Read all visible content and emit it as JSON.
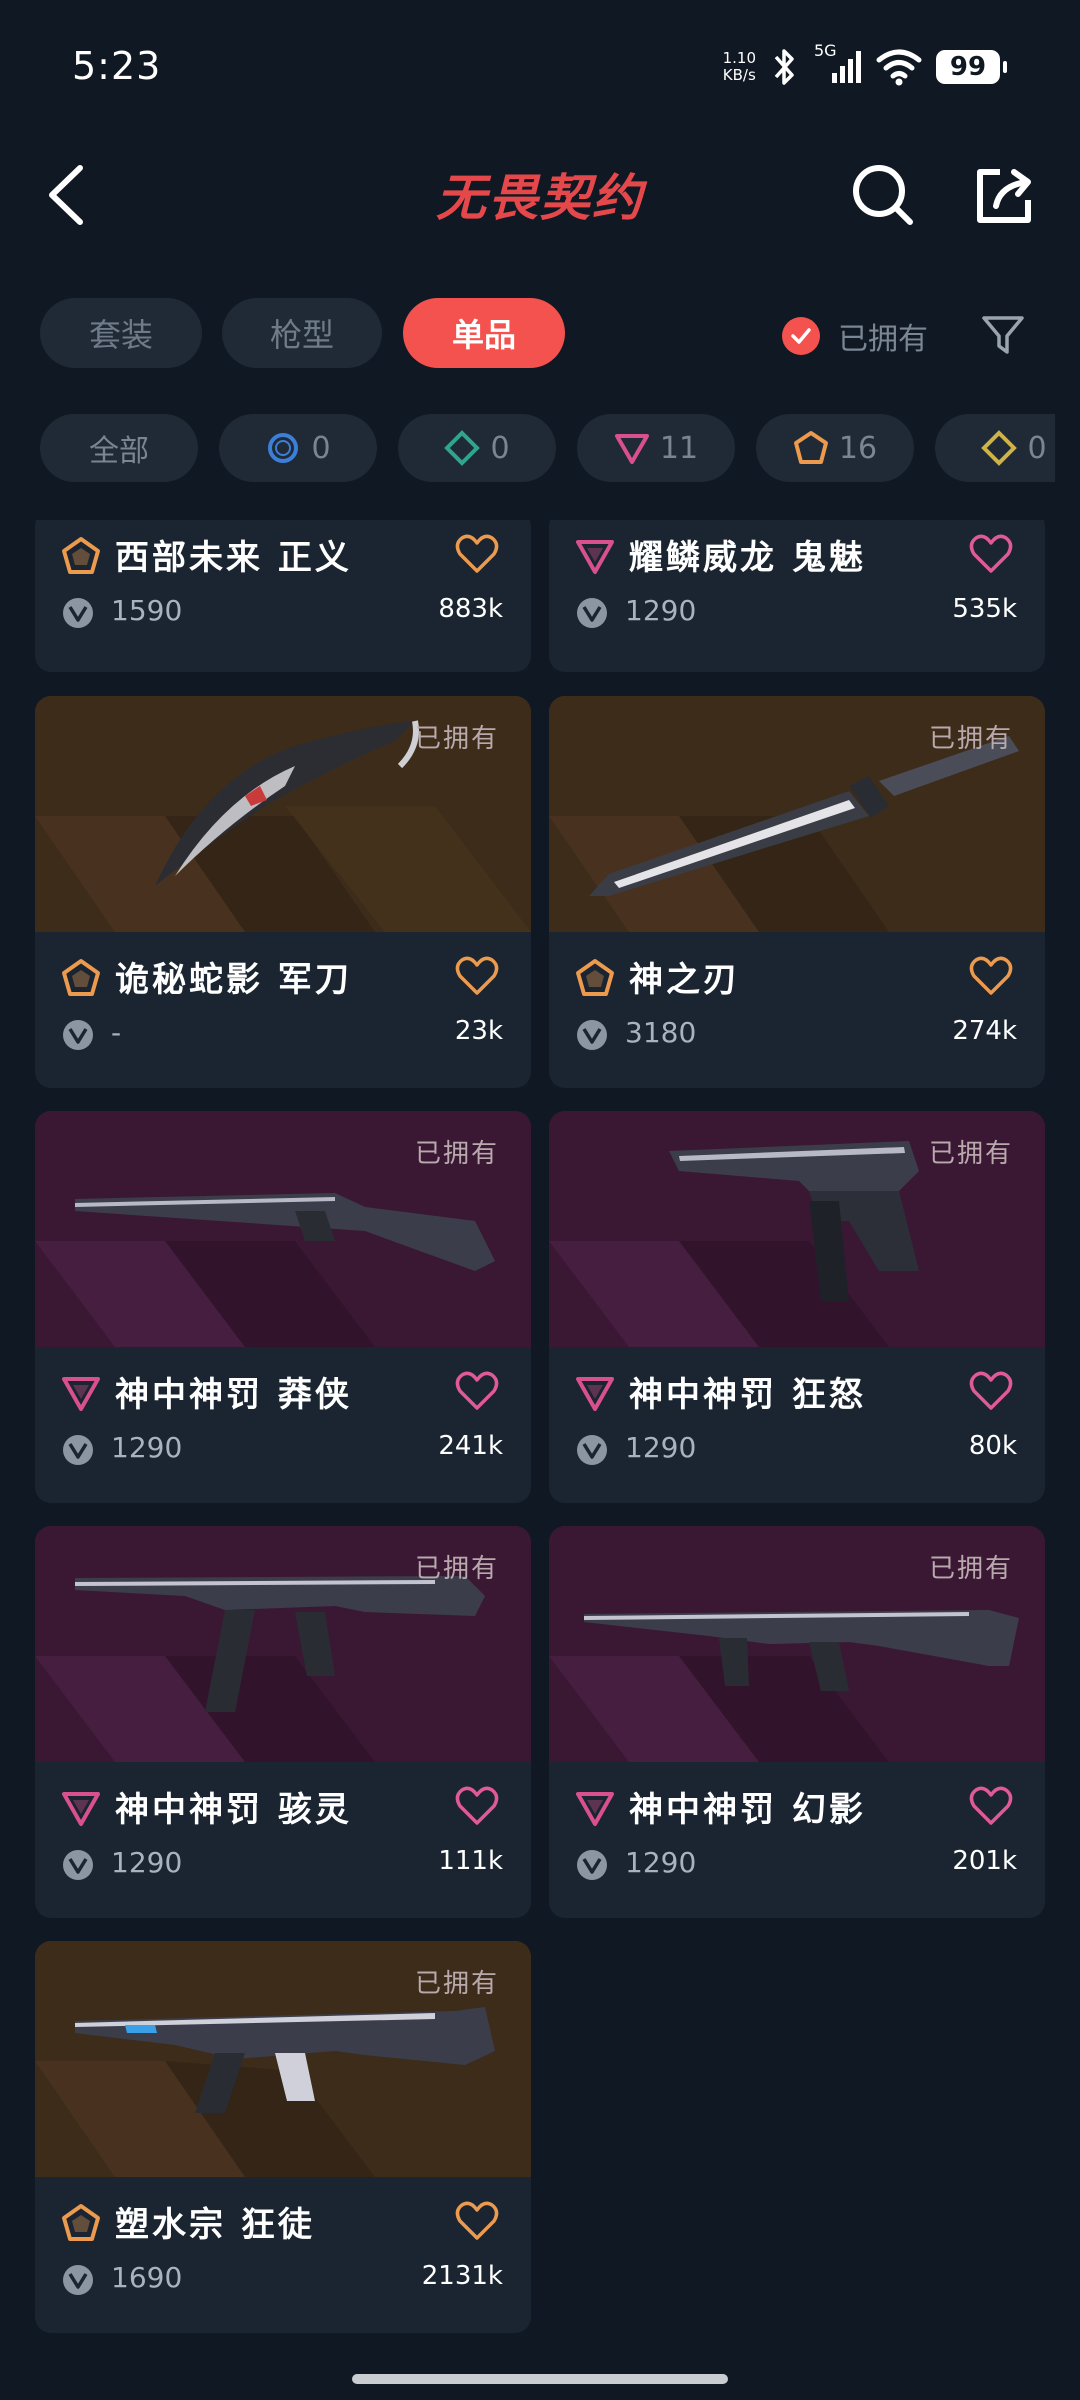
{
  "status": {
    "time": "5:23",
    "net_speed": "1.10",
    "net_unit": "KB/s",
    "signal_label": "5G",
    "battery": "99"
  },
  "header": {
    "title": "无畏契约"
  },
  "tabs": [
    {
      "label": "套装",
      "active": false
    },
    {
      "label": "枪型",
      "active": false
    },
    {
      "label": "单品",
      "active": true
    }
  ],
  "owned_filter": {
    "label": "已拥有",
    "checked": true
  },
  "tiers": [
    {
      "label": "全部",
      "icon": "none"
    },
    {
      "count": "0",
      "icon": "circle-blue",
      "color": "#3c7fd8"
    },
    {
      "count": "0",
      "icon": "diamond-green",
      "color": "#2fa58f"
    },
    {
      "count": "11",
      "icon": "triangle-pink",
      "color": "#d9508e"
    },
    {
      "count": "16",
      "icon": "pentagon-orange",
      "color": "#ec9a4e"
    },
    {
      "count": "0",
      "icon": "diamond-yellow",
      "color": "#cfb34a"
    }
  ],
  "owned_tag": "已拥有",
  "cards": [
    {
      "name": "西部未来 正义",
      "tier": "pentagon-orange",
      "price": "1590",
      "likes": "883k",
      "image": "none"
    },
    {
      "name": "耀鳞威龙 鬼魅",
      "tier": "triangle-pink",
      "price": "1290",
      "likes": "535k",
      "image": "none"
    },
    {
      "name": "诡秘蛇影 军刀",
      "tier": "pentagon-orange",
      "price": "-",
      "likes": "23k",
      "image": "karambit-knife",
      "bg": "gold"
    },
    {
      "name": "神之刃",
      "tier": "pentagon-orange",
      "price": "3180",
      "likes": "274k",
      "image": "blade-knife",
      "bg": "gold"
    },
    {
      "name": "神中神罚 莽侠",
      "tier": "triangle-pink",
      "price": "1290",
      "likes": "241k",
      "image": "shotgun",
      "bg": "purple"
    },
    {
      "name": "神中神罚 狂怒",
      "tier": "triangle-pink",
      "price": "1290",
      "likes": "80k",
      "image": "pistol",
      "bg": "purple"
    },
    {
      "name": "神中神罚 骇灵",
      "tier": "triangle-pink",
      "price": "1290",
      "likes": "111k",
      "image": "smg",
      "bg": "purple"
    },
    {
      "name": "神中神罚 幻影",
      "tier": "triangle-pink",
      "price": "1290",
      "likes": "201k",
      "image": "rifle",
      "bg": "purple"
    },
    {
      "name": "塑水宗 狂徒",
      "tier": "pentagon-orange",
      "price": "1690",
      "likes": "2131k",
      "image": "rifle-vandal",
      "bg": "gold"
    }
  ],
  "colors": {
    "accent": "#f4524f",
    "background": "#0f1823",
    "card": "#1a2531",
    "heart_orange": "#ec9a4e",
    "heart_pink": "#e05a95"
  }
}
